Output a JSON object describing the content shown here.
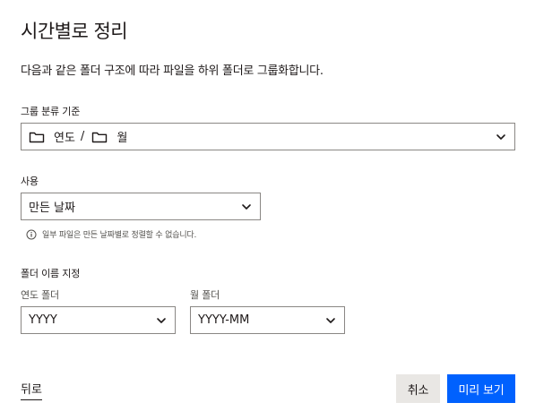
{
  "dialog": {
    "title": "시간별로 정리",
    "description": "다음과 같은 폴더 구조에 따라 파일을 하위 폴더로 그룹화합니다."
  },
  "grouping": {
    "label": "그룹 분류 기준",
    "value_part1": "연도",
    "separator": "/",
    "value_part2": "월",
    "icons": [
      "folder-icon",
      "folder-icon",
      "chevron-down-icon"
    ]
  },
  "use": {
    "label": "사용",
    "value": "만든 날짜",
    "info_text": "일부 파일은 만든 날짜별로 정렬할 수 없습니다.",
    "info_icon": "info-icon"
  },
  "folder_naming": {
    "label": "폴더 이름 지정",
    "year": {
      "label": "연도 폴더",
      "value": "YYYY"
    },
    "month": {
      "label": "월 폴더",
      "value": "YYYY-MM"
    }
  },
  "footer": {
    "back_label": "뒤로",
    "cancel_label": "취소",
    "preview_label": "미리 보기"
  },
  "colors": {
    "primary": "#0061fe",
    "secondary_bg": "#e9e7e4",
    "text": "#1e1919",
    "border": "#8a8784"
  }
}
